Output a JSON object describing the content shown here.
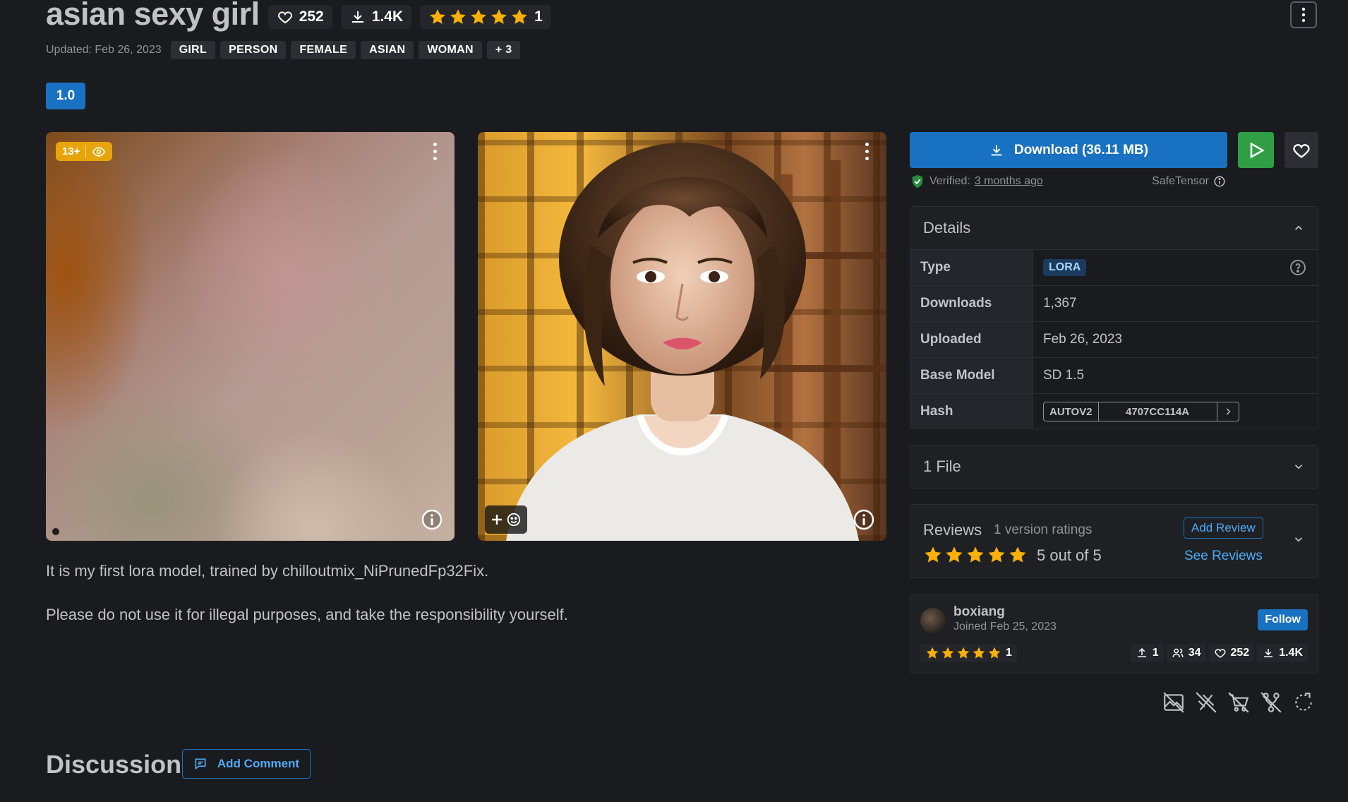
{
  "model": {
    "title": "asian sexy girl",
    "likes": "252",
    "downloads": "1.4K",
    "rating_count": "1",
    "rating_value": 5,
    "updated": "Updated: Feb 26, 2023",
    "tags": [
      "GIRL",
      "PERSON",
      "FEMALE",
      "ASIAN",
      "WOMAN"
    ],
    "more_tags": "+ 3",
    "version": "1.0"
  },
  "gallery": {
    "nsfw_badge": "13+",
    "images": [
      {
        "name": "blurred-preview",
        "blurred": true
      },
      {
        "name": "portrait-preview",
        "blurred": false
      }
    ]
  },
  "description": [
    "It is my first lora model, trained by chilloutmix_NiPrunedFp32Fix.",
    "Please do not use it for illegal purposes, and take the responsibility yourself."
  ],
  "download": {
    "label": "Download (36.11 MB)",
    "verified_label": "Verified:",
    "verified_when": "3 months ago",
    "format": "SafeTensor"
  },
  "details": {
    "heading": "Details",
    "rows": [
      {
        "key": "Type",
        "value": "LORA"
      },
      {
        "key": "Downloads",
        "value": "1,367"
      },
      {
        "key": "Uploaded",
        "value": "Feb 26, 2023"
      },
      {
        "key": "Base Model",
        "value": "SD 1.5"
      },
      {
        "key": "Hash",
        "value": ""
      }
    ],
    "hash_type": "AUTOV2",
    "hash_value": "4707CC114A"
  },
  "files": {
    "heading": "1 File"
  },
  "reviews": {
    "heading": "Reviews",
    "subtitle": "1 version ratings",
    "score_text": "5 out of 5",
    "add_review": "Add Review",
    "see_reviews": "See Reviews"
  },
  "creator": {
    "name": "boxiang",
    "joined": "Joined Feb 25, 2023",
    "follow": "Follow",
    "rating_count": "1",
    "uploads": "1",
    "followers": "34",
    "likes": "252",
    "downloads": "1.4K"
  },
  "discussion": {
    "heading": "Discussion",
    "add_comment": "Add Comment"
  },
  "colors": {
    "accent": "#1971c2",
    "star": "#fab005",
    "play": "#2f9e44",
    "background": "#1a1b1e"
  }
}
